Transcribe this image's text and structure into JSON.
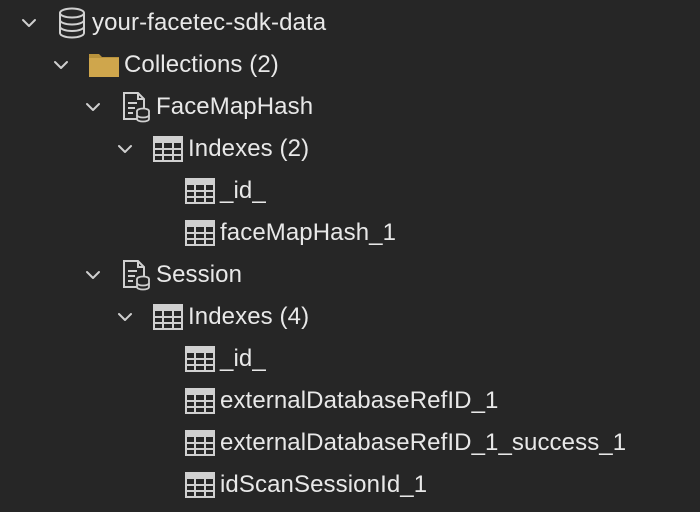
{
  "tree": {
    "database": {
      "label": "your-facetec-sdk-data",
      "icon": "database-icon",
      "expanded": true
    },
    "collections": {
      "label": "Collections (2)",
      "icon": "folder-icon",
      "expanded": true,
      "color": "#c9a24a"
    },
    "facemaphash": {
      "label": "FaceMapHash",
      "icon": "collection-document-icon",
      "expanded": true,
      "indexes": {
        "label": "Indexes (2)",
        "icon": "index-table-icon",
        "expanded": true,
        "items": [
          "_id_",
          "faceMapHash_1"
        ]
      }
    },
    "session": {
      "label": "Session",
      "icon": "collection-document-icon",
      "expanded": true,
      "indexes": {
        "label": "Indexes (4)",
        "icon": "index-table-icon",
        "expanded": true,
        "items": [
          "_id_",
          "externalDatabaseRefID_1",
          "externalDatabaseRefID_1_success_1",
          "idScanSessionId_1"
        ]
      }
    }
  },
  "colors": {
    "background": "#262626",
    "text": "#e8e8e8",
    "icon": "#d0d0d0",
    "folder": "#c9a24a"
  }
}
